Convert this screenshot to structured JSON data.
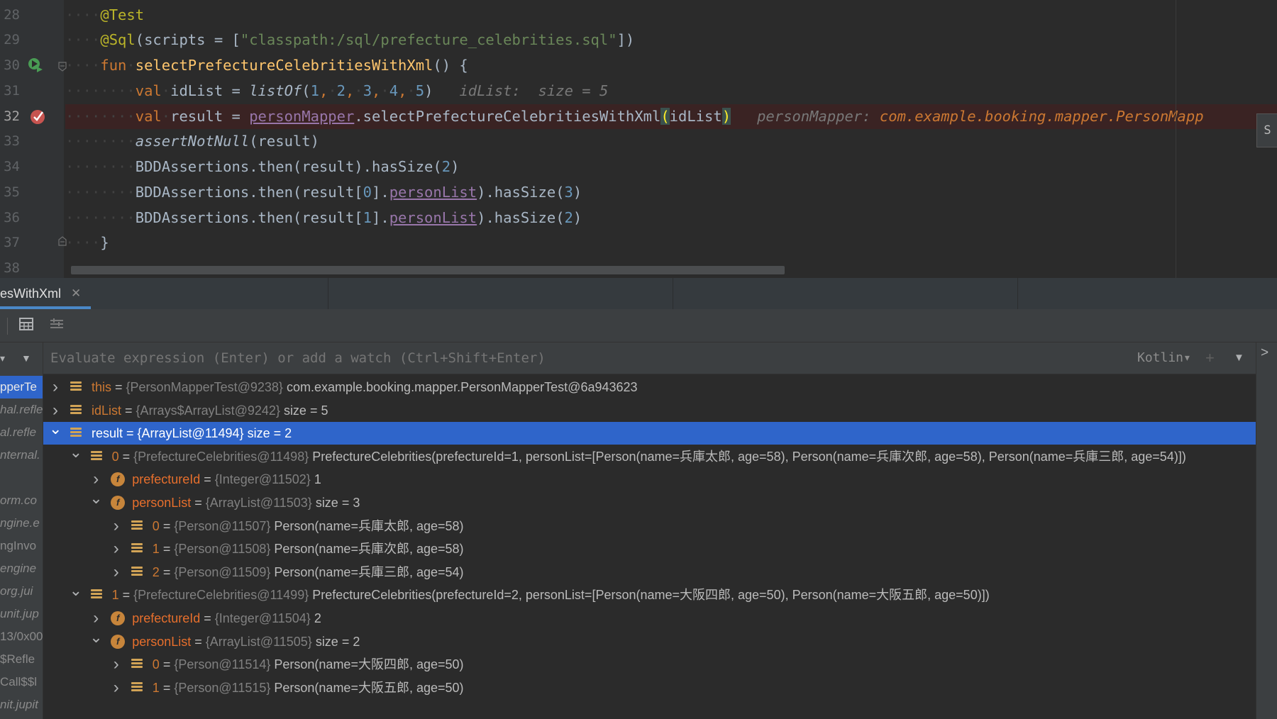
{
  "editor": {
    "gutter_lines": [
      "28",
      "29",
      "30",
      "31",
      "32",
      "33",
      "34",
      "35",
      "36",
      "37",
      "38"
    ],
    "line28": {
      "annotation": "@Test"
    },
    "line29": {
      "annotation": "@Sql",
      "open": "(scripts = [",
      "string": "\"classpath:/sql/prefecture_celebrities.sql\"",
      "close": "])"
    },
    "line30": {
      "keyword": "fun",
      "function_name": "selectPrefectureCelebritiesWithXml",
      "rest": "() {"
    },
    "line31": {
      "keyword": "val",
      "var": "idList",
      "eq": " = ",
      "call": "listOf",
      "open": "(",
      "n1": "1",
      "n2": "2",
      "n3": "3",
      "n4": "4",
      "n5": "5",
      "close": ")",
      "hint": "idList:  size = 5"
    },
    "line32": {
      "keyword": "val",
      "var": "result",
      "eq": " = ",
      "receiver": "personMapper",
      "call": ".selectPrefectureCelebritiesWithXml",
      "open_paren": "(",
      "arg": "idList",
      "close_paren": ")",
      "hint_label": "personMapper: ",
      "hint_value": "com.example.booking.mapper.PersonMapp"
    },
    "line33": {
      "call": "assertNotNull",
      "rest": "(result)"
    },
    "line34": {
      "pre": "BDDAssertions.then(result).hasSize(",
      "num": "2",
      "post": ")"
    },
    "line35": {
      "pre": "BDDAssertions.then(result[",
      "idx": "0",
      "mid": "].",
      "prop": "personList",
      "post1": ").hasSize(",
      "num": "3",
      "post2": ")"
    },
    "line36": {
      "pre": "BDDAssertions.then(result[",
      "idx": "1",
      "mid": "].",
      "prop": "personList",
      "post1": ").hasSize(",
      "num": "2",
      "post2": ")"
    },
    "line37": {
      "text": "}"
    },
    "right_tab": "S"
  },
  "debug": {
    "tab_label": "esWithXml",
    "eval_placeholder": "Evaluate expression (Enter) or add a watch (Ctrl+Shift+Enter)",
    "language": "Kotlin▾",
    "frames": [
      "pperTe",
      "hal.refle",
      "al.refle",
      "nternal.",
      "",
      "orm.co",
      "ngine.e",
      "ngInvo",
      "engine",
      "org.jui",
      "unit.jup",
      "13/0x00",
      "$Refle",
      "Call$$l",
      "nit.jupit"
    ],
    "variables": [
      {
        "name": "this",
        "type": "{PersonMapperTest@9238}",
        "value": "com.example.booking.mapper.PersonMapperTest@6a943623"
      },
      {
        "name": "idList",
        "type": "{Arrays$ArrayList@9242}",
        "value": " size = 5"
      },
      {
        "name": "result",
        "type": "{ArrayList@11494}",
        "value": " size = 2"
      },
      {
        "name": "0",
        "type": "{PrefectureCelebrities@11498}",
        "value": "PrefectureCelebrities(prefectureId=1, personList=[Person(name=兵庫太郎, age=58), Person(name=兵庫次郎, age=58), Person(name=兵庫三郎, age=54)])"
      },
      {
        "name": "prefectureId",
        "type": "{Integer@11502}",
        "value": "1"
      },
      {
        "name": "personList",
        "type": "{ArrayList@11503}",
        "value": " size = 3"
      },
      {
        "name": "0",
        "type": "{Person@11507}",
        "value": "Person(name=兵庫太郎, age=58)"
      },
      {
        "name": "1",
        "type": "{Person@11508}",
        "value": "Person(name=兵庫次郎, age=58)"
      },
      {
        "name": "2",
        "type": "{Person@11509}",
        "value": "Person(name=兵庫三郎, age=54)"
      },
      {
        "name": "1",
        "type": "{PrefectureCelebrities@11499}",
        "value": "PrefectureCelebrities(prefectureId=2, personList=[Person(name=大阪四郎, age=50), Person(name=大阪五郎, age=50)])"
      },
      {
        "name": "prefectureId",
        "type": "{Integer@11504}",
        "value": "2"
      },
      {
        "name": "personList",
        "type": "{ArrayList@11505}",
        "value": " size = 2"
      },
      {
        "name": "0",
        "type": "{Person@11514}",
        "value": "Person(name=大阪四郎, age=50)"
      },
      {
        "name": "1",
        "type": "{Person@11515}",
        "value": "Person(name=大阪五郎, age=50)"
      }
    ]
  },
  "colors": {
    "accent": "#2f65ca",
    "breakpoint": "#c75450",
    "keyword": "#cc7832",
    "string": "#6a8759",
    "number": "#6897bb"
  }
}
